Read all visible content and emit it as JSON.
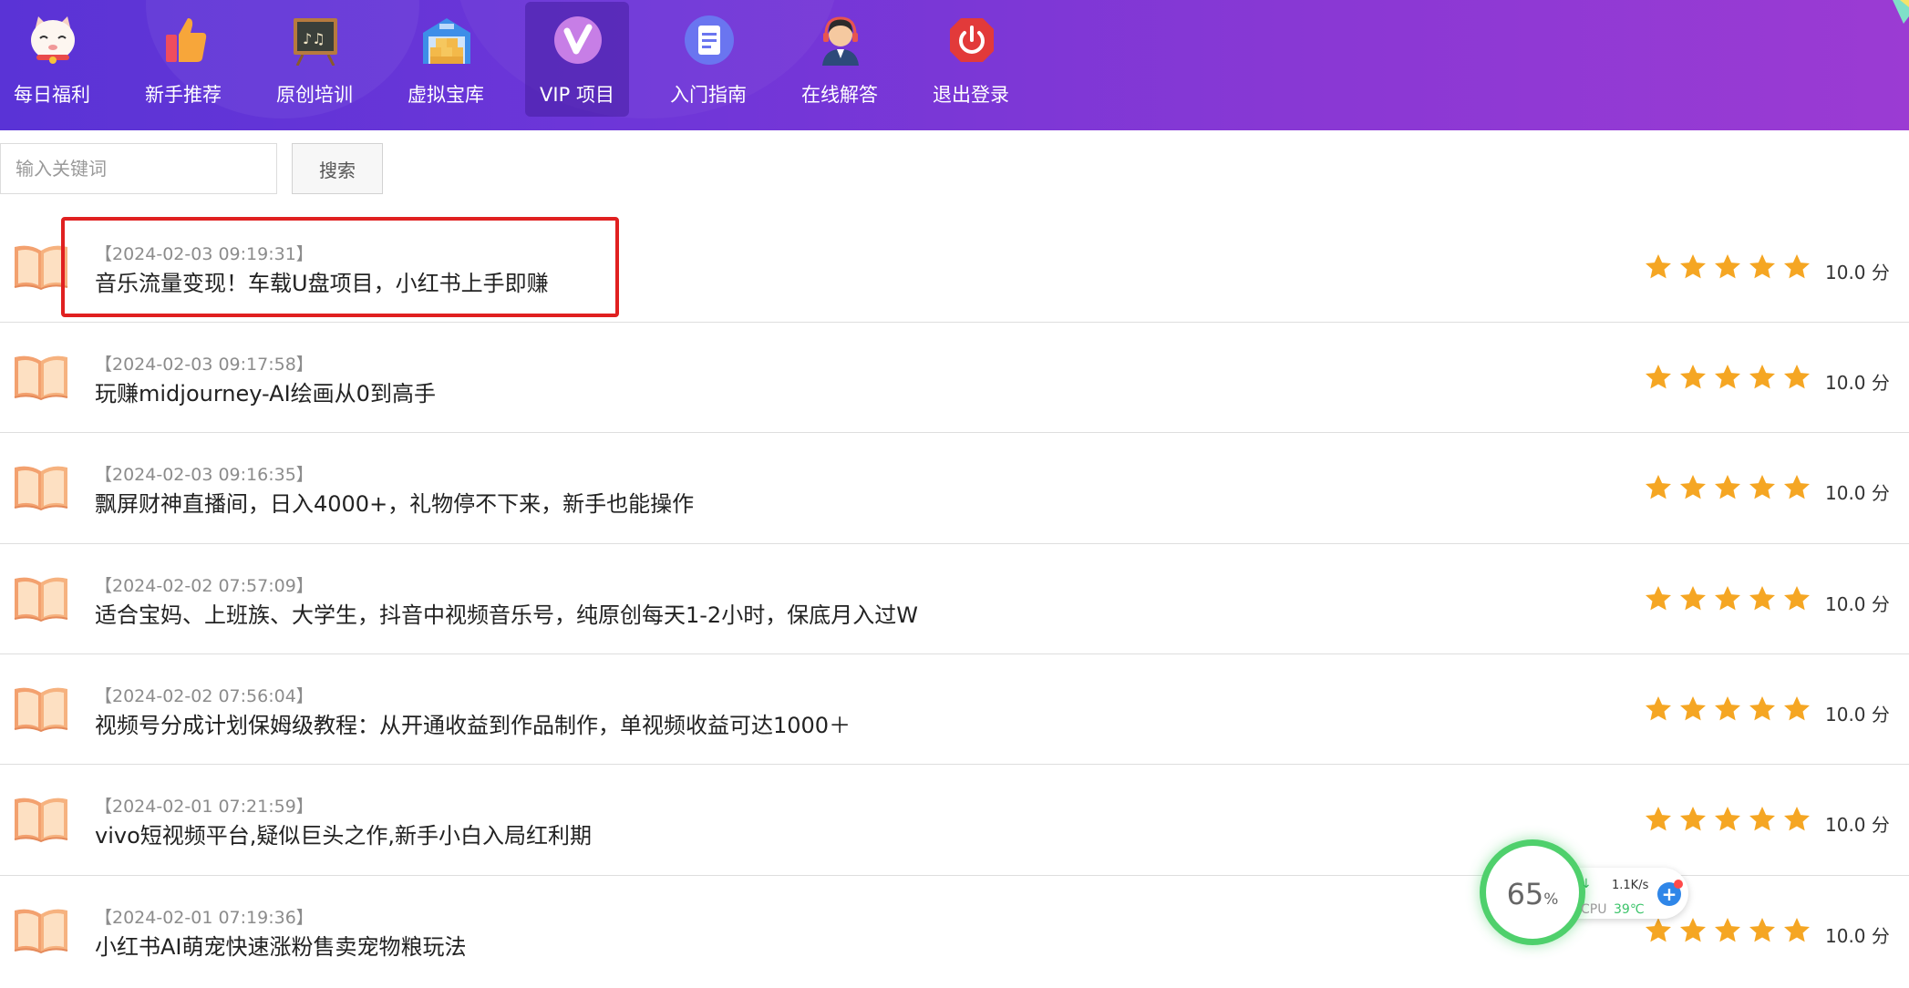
{
  "nav": {
    "items": [
      {
        "label": "每日福利",
        "icon": "lucky-cat-icon"
      },
      {
        "label": "新手推荐",
        "icon": "thumbs-up-icon"
      },
      {
        "label": "原创培训",
        "icon": "music-chalkboard-icon"
      },
      {
        "label": "虚拟宝库",
        "icon": "warehouse-icon"
      },
      {
        "label": "VIP 项目",
        "icon": "vip-badge-icon",
        "active": true
      },
      {
        "label": "入门指南",
        "icon": "document-icon"
      },
      {
        "label": "在线解答",
        "icon": "support-agent-icon"
      },
      {
        "label": "退出登录",
        "icon": "power-icon"
      }
    ]
  },
  "search": {
    "placeholder": "输入关键词",
    "value": "",
    "button_label": "搜索"
  },
  "list": {
    "rating_stars": 5,
    "items": [
      {
        "date": "【2024-02-03 09:19:31】",
        "title": "音乐流量变现！车载U盘项目，小红书上手即赚",
        "score": "10.0 分",
        "highlighted": true
      },
      {
        "date": "【2024-02-03 09:17:58】",
        "title": "玩赚midjourney-AI绘画从0到高手",
        "score": "10.0 分"
      },
      {
        "date": "【2024-02-03 09:16:35】",
        "title": "飘屏财神直播间，日入4000+，礼物停不下来，新手也能操作",
        "score": "10.0 分"
      },
      {
        "date": "【2024-02-02 07:57:09】",
        "title": "适合宝妈、上班族、大学生，抖音中视频音乐号，纯原创每天1-2小时，保底月入过W",
        "score": "10.0 分"
      },
      {
        "date": "【2024-02-02 07:56:04】",
        "title": "视频号分成计划保姆级教程：从开通收益到作品制作，单视频收益可达1000＋",
        "score": "10.0 分"
      },
      {
        "date": "【2024-02-01 07:21:59】",
        "title": "vivo短视频平台,疑似巨头之作,新手小白入局红利期",
        "score": "10.0 分"
      },
      {
        "date": "【2024-02-01 07:19:36】",
        "title": "小红书AI萌宠快速涨粉售卖宠物粮玩法",
        "score": "10.0 分"
      }
    ]
  },
  "monitor": {
    "usage_value": "65",
    "usage_unit": "%",
    "net_speed": "1.1K/s",
    "cpu_label": "CPU",
    "cpu_temp": "39℃"
  },
  "colors": {
    "nav_gradient_start": "#5a33d6",
    "nav_gradient_end": "#9b3bd3",
    "star": "#f5a623",
    "highlight_border": "#e02020"
  }
}
